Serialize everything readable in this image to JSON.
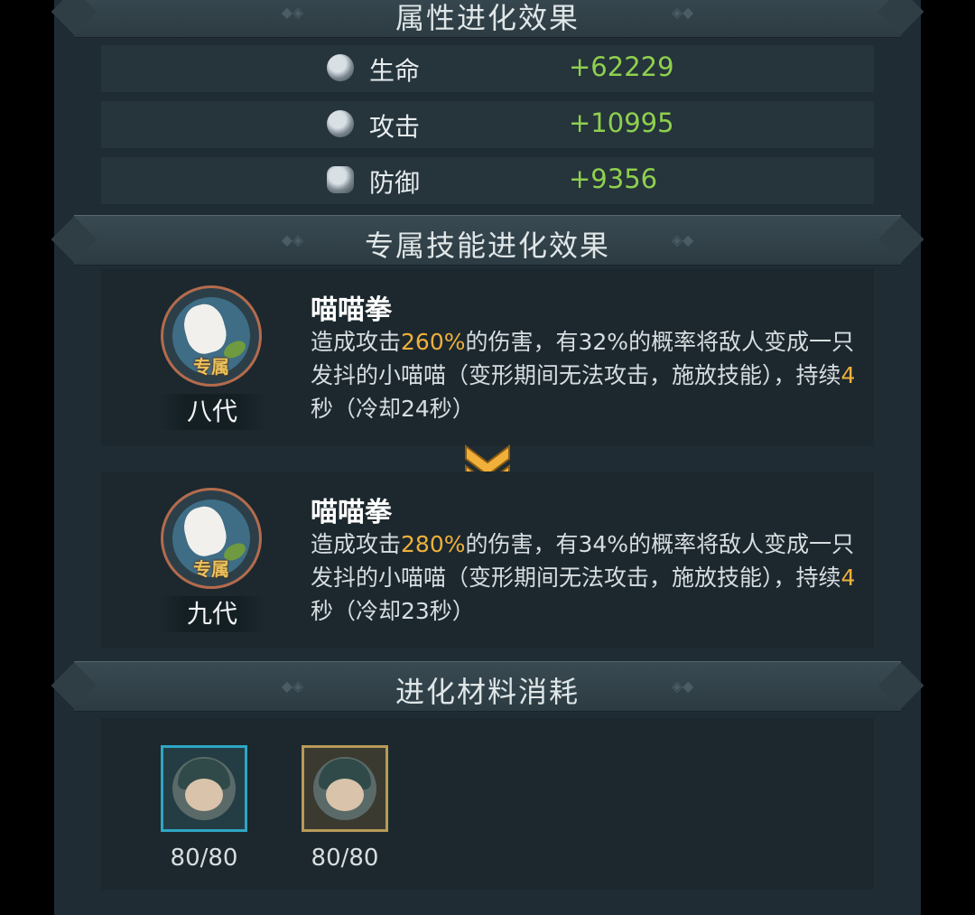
{
  "sections": {
    "attributes_title": "属性进化效果",
    "skill_title": "专属技能进化效果",
    "materials_title": "进化材料消耗"
  },
  "attributes": [
    {
      "icon": "heart-shield-icon",
      "label": "生命",
      "value": "+62229"
    },
    {
      "icon": "sword-shield-icon",
      "label": "攻击",
      "value": "+10995"
    },
    {
      "icon": "armor-shield-icon",
      "label": "防御",
      "value": "+9356"
    }
  ],
  "skills": [
    {
      "tag": "专属",
      "generation": "八代",
      "name": "喵喵拳",
      "desc_1": "造成攻击",
      "pct": "260%",
      "desc_2": "的伤害，有32%的概率将敌人变成一只发抖的小喵喵（变形期间无法攻击，施放技能），持续",
      "dur": "4",
      "desc_3": "秒（冷却24秒）"
    },
    {
      "tag": "专属",
      "generation": "九代",
      "name": "喵喵拳",
      "desc_1": "造成攻击",
      "pct": "280%",
      "desc_2": "的伤害，有34%的概率将敌人变成一只发抖的小喵喵（变形期间无法攻击，施放技能），持续",
      "dur": "4",
      "desc_3": "秒（冷却23秒）"
    }
  ],
  "materials": [
    {
      "count": "80/80",
      "frame": "#2fa6c4"
    },
    {
      "count": "80/80",
      "frame": "#b89a58"
    }
  ],
  "colors": {
    "value_green": "#8ed04e",
    "highlight": "#f0b03a",
    "arrow": "#f0b03a"
  }
}
